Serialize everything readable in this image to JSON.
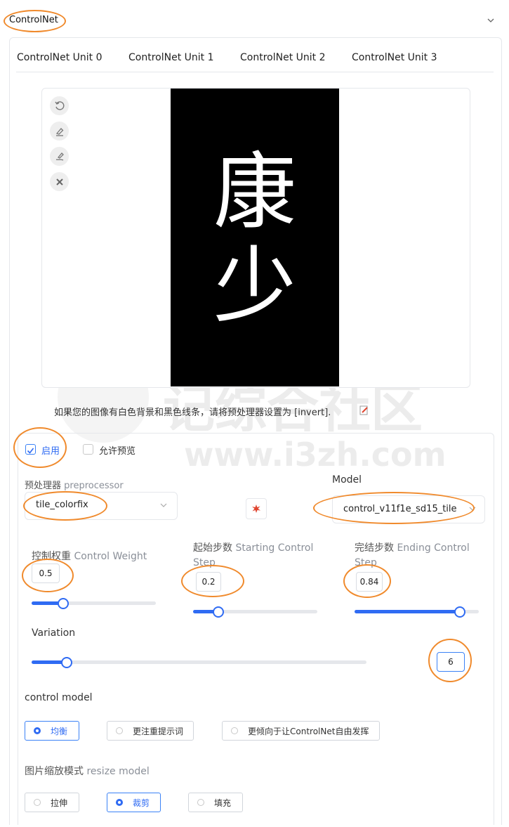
{
  "accordion": {
    "title": "ControlNet"
  },
  "tabs": [
    "ControlNet Unit 0",
    "ControlNet Unit 1",
    "ControlNet Unit 2",
    "ControlNet Unit 3"
  ],
  "image": {
    "char_top": "康",
    "char_bottom": "少"
  },
  "tools": [
    "undo-icon",
    "eraser-icon",
    "brush-icon",
    "close-icon"
  ],
  "invert_note": "如果您的图像有白色背景和黑色线条，请将预处理器设置为 [invert].",
  "enable": {
    "label": "启用",
    "checked": true
  },
  "allow_preview": {
    "label": "允许预览",
    "checked": false
  },
  "preprocessor": {
    "label_cn": "预处理器",
    "label_en": "preprocessor",
    "value": "tile_colorfix"
  },
  "model": {
    "label": "Model",
    "value": "control_v11f1e_sd15_tile"
  },
  "control_weight": {
    "label_cn": "控制权重",
    "label_en": "Control Weight",
    "value": "0.5",
    "fraction": 0.25
  },
  "starting_step": {
    "label_cn": "起始步数",
    "label_en": "Starting Control",
    "label_en2": "Step",
    "value": "0.2",
    "fraction": 0.2
  },
  "ending_step": {
    "label_cn": "完结步数",
    "label_en": "Ending Control",
    "label_en2": "Step",
    "value": "0.84",
    "fraction": 0.84
  },
  "variation": {
    "label": "Variation",
    "value": "6"
  },
  "control_model": {
    "label": "control model",
    "options": [
      "均衡",
      "更注重提示词",
      "更倾向于让ControlNet自由发挥"
    ],
    "selected": 0
  },
  "resize_model": {
    "label_cn": "图片缩放模式",
    "label_en": "resize model",
    "options": [
      "拉伸",
      "裁剪",
      "填充"
    ],
    "selected": 1
  },
  "watermark": {
    "text": "记综合社区",
    "url": "www.i3zh.com"
  },
  "colors": {
    "accent": "#2f6bf3",
    "annotation": "#f08a2c"
  }
}
